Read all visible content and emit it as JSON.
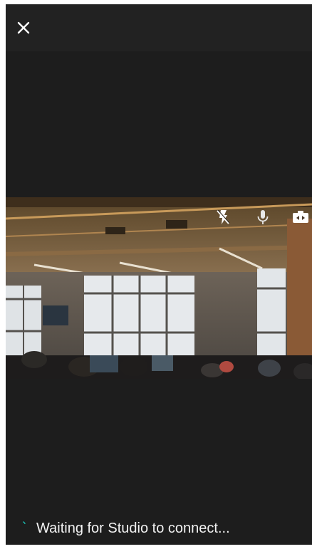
{
  "app": {
    "background_color": "#1d1d1d",
    "topbar_color": "#222222"
  },
  "toolbar": {
    "close_icon": "close-icon"
  },
  "camera": {
    "controls": [
      {
        "icon": "flash-off-icon"
      },
      {
        "icon": "microphone-icon"
      },
      {
        "icon": "switch-camera-icon"
      }
    ]
  },
  "status": {
    "text": "Waiting for Studio to connect...",
    "spinner_color": "#1aa39a"
  }
}
